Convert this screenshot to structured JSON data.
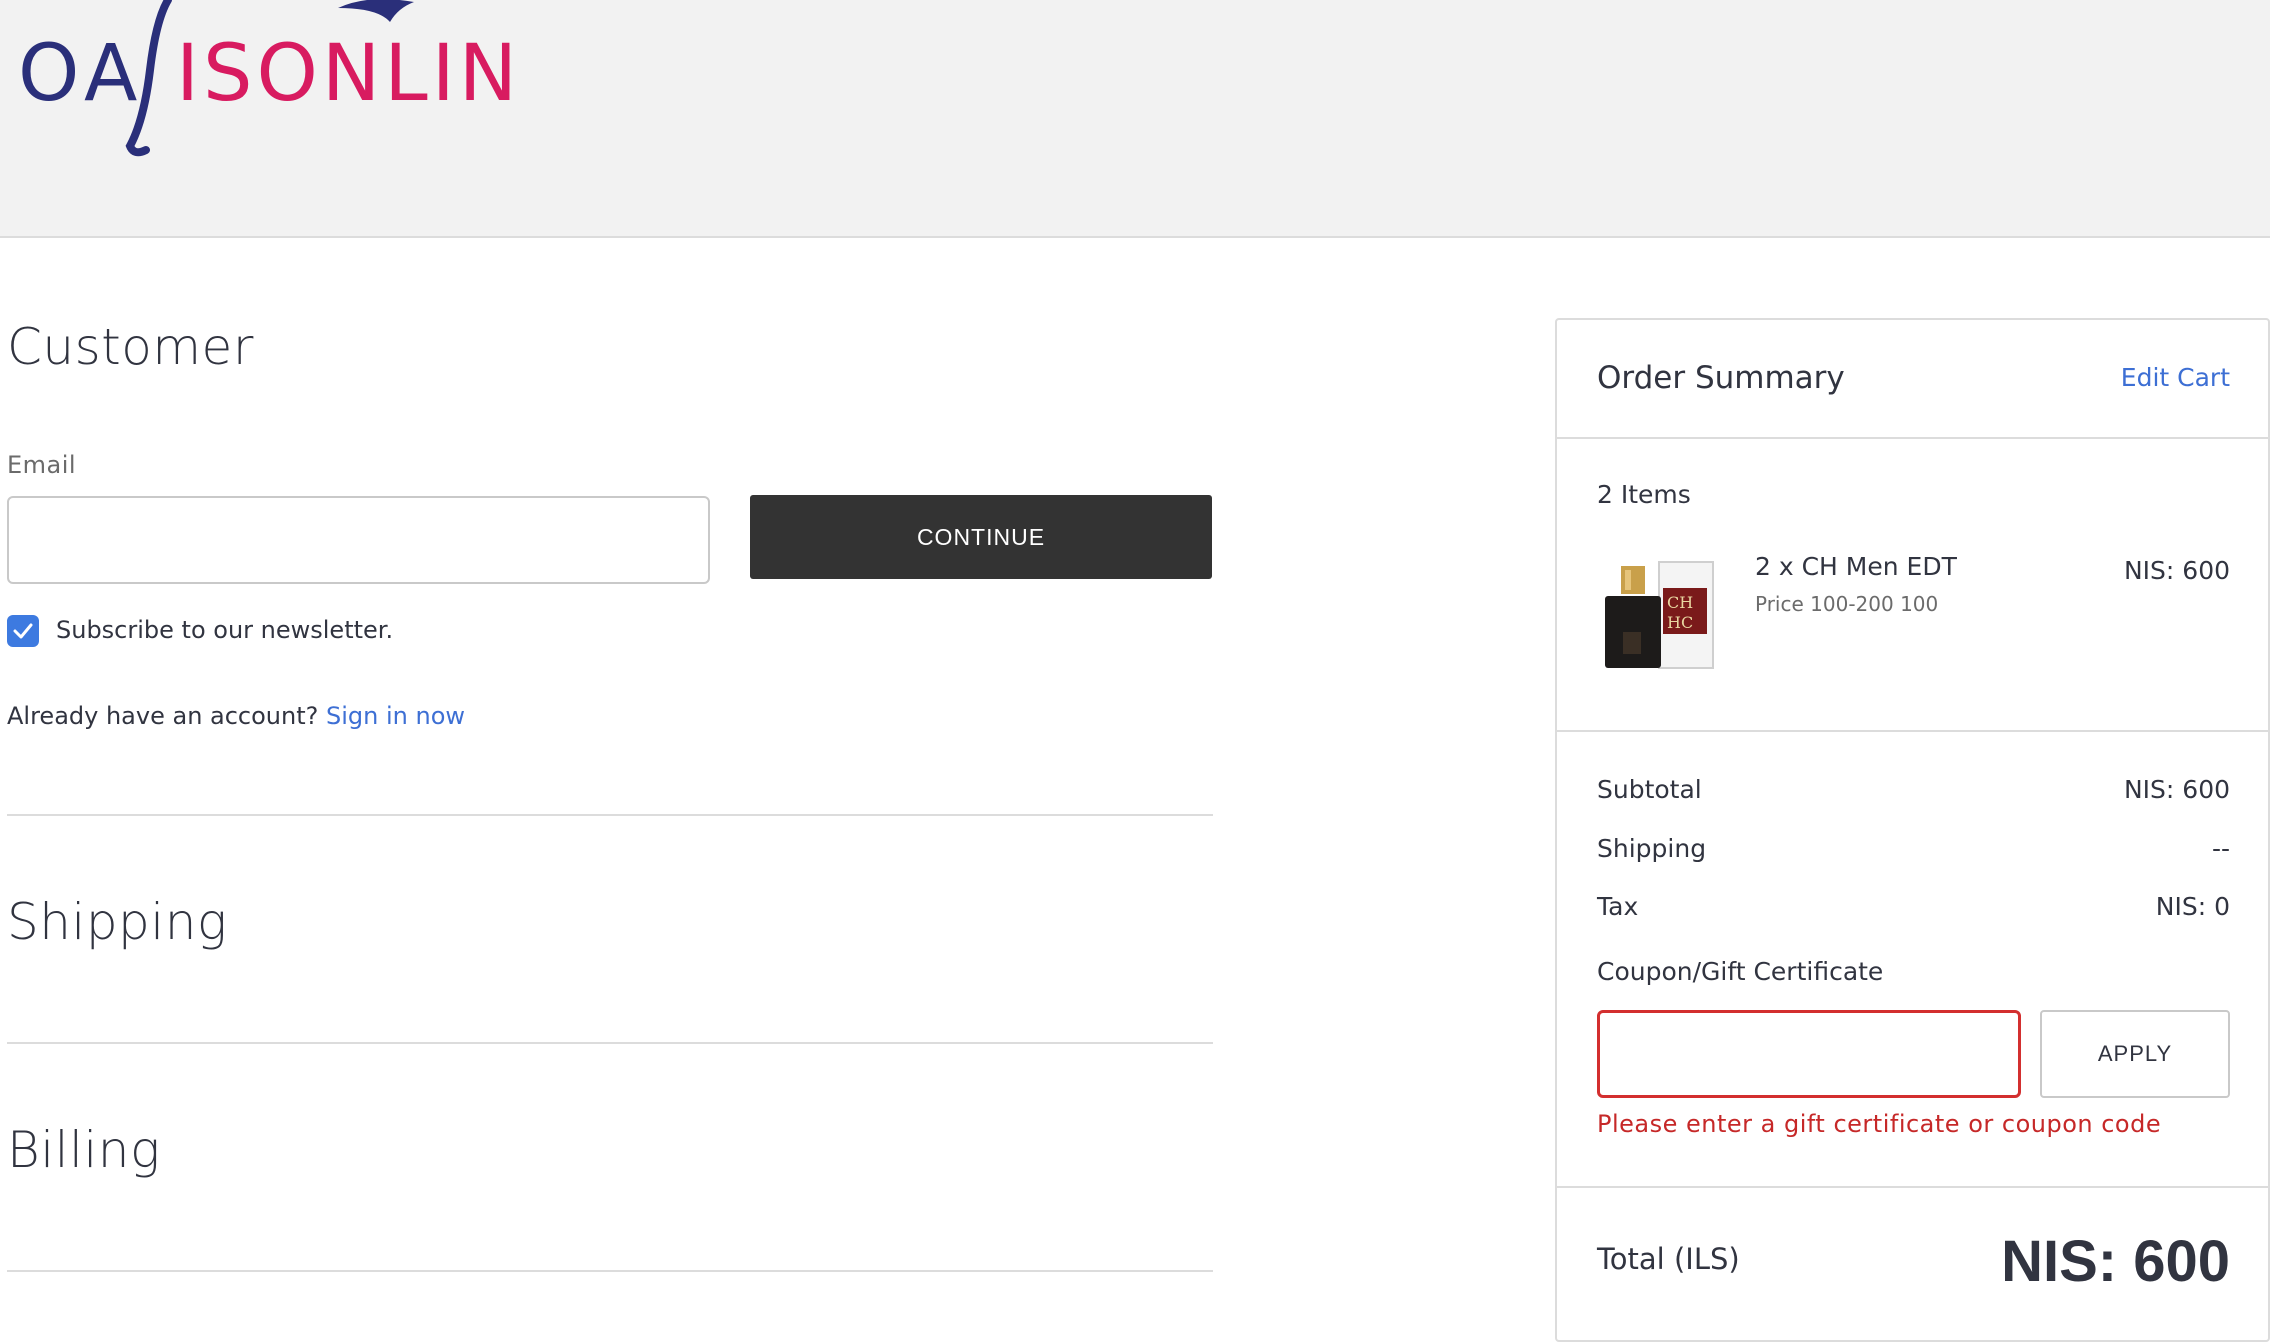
{
  "header": {
    "logo_text": "OASISONLINE",
    "logo_left": "OA",
    "logo_right": "ISONLINE"
  },
  "customer": {
    "title": "Customer",
    "email_label": "Email",
    "email_value": "",
    "continue_label": "CONTINUE",
    "newsletter_checked": true,
    "newsletter_label": "Subscribe to our newsletter.",
    "account_prompt": "Already have an account?",
    "sign_in_label": "Sign in now"
  },
  "shipping": {
    "title": "Shipping"
  },
  "billing": {
    "title": "Billing"
  },
  "order_summary": {
    "title": "Order Summary",
    "edit_cart_label": "Edit Cart",
    "items_count": "2 Items",
    "items": [
      {
        "name": "2 x CH Men EDT",
        "meta": "Price 100-200 100",
        "price": "NIS: 600",
        "image_icon": "perfume-bottle-icon"
      }
    ],
    "subtotal_label": "Subtotal",
    "subtotal_value": "NIS: 600",
    "shipping_label": "Shipping",
    "shipping_value": "--",
    "tax_label": "Tax",
    "tax_value": "NIS: 0",
    "coupon_label": "Coupon/Gift Certificate",
    "coupon_value": "",
    "apply_label": "APPLY",
    "coupon_error": "Please enter a gift certificate or coupon code",
    "total_label": "Total (ILS)",
    "total_value": "NIS: 600"
  },
  "colors": {
    "accent_link": "#3d6fd4",
    "button_dark": "#333333",
    "error": "#c62828",
    "checkbox": "#3d7ae0",
    "logo_navy": "#2a2f7a",
    "logo_magenta": "#d81b60"
  }
}
